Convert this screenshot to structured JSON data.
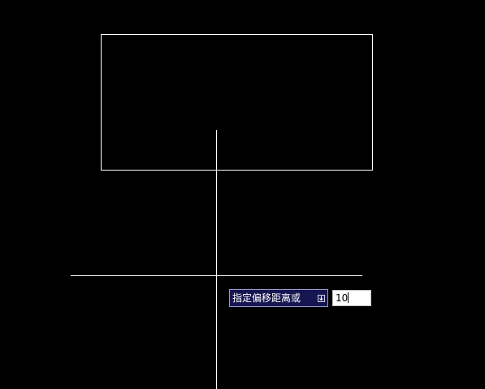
{
  "drawing": {
    "background_color": "#000000",
    "line_color": "#ffffff"
  },
  "command_prompt": {
    "text": "指定偏移距离或",
    "dropdown_icon": "arrow-down-icon"
  },
  "distance_input": {
    "value": "10"
  }
}
